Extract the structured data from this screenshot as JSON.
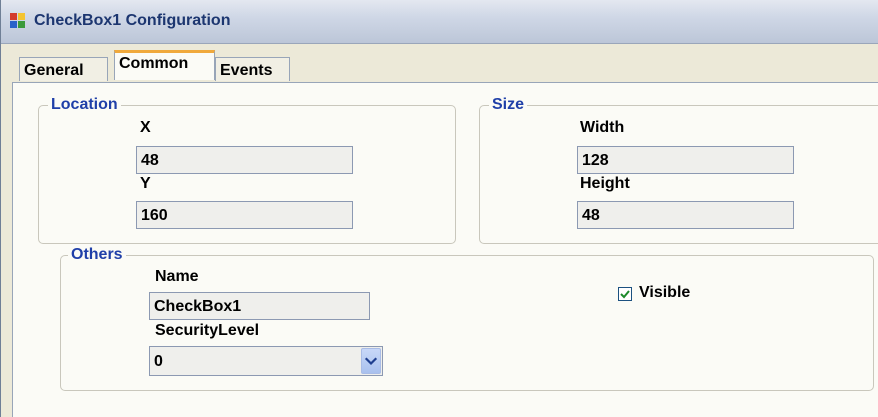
{
  "window": {
    "title": "CheckBox1 Configuration",
    "icon": "app-window-icon"
  },
  "tabs": [
    {
      "label": "General",
      "active": false
    },
    {
      "label": "Common",
      "active": true
    },
    {
      "label": "Events",
      "active": false
    }
  ],
  "location": {
    "legend": "Location",
    "x_label": "X",
    "x_value": "48",
    "y_label": "Y",
    "y_value": "160"
  },
  "size": {
    "legend": "Size",
    "width_label": "Width",
    "width_value": "128",
    "height_label": "Height",
    "height_value": "48"
  },
  "others": {
    "legend": "Others",
    "name_label": "Name",
    "name_value": "CheckBox1",
    "security_label": "SecurityLevel",
    "security_value": "0",
    "visible_label": "Visible",
    "visible_checked": true
  },
  "colors": {
    "legend": "#1f3fa8",
    "active_tab_accent": "#f0a93c",
    "titlebar_text": "#1c3670"
  }
}
